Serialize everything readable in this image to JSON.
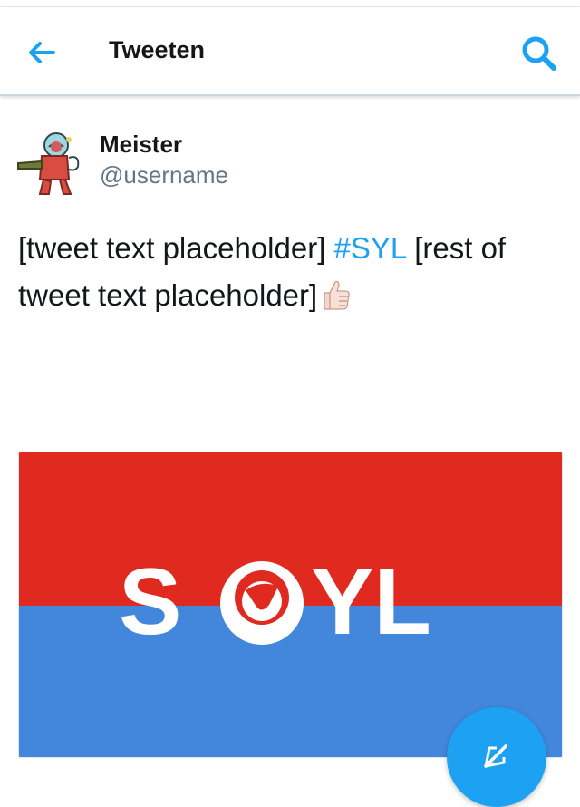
{
  "header": {
    "title": "Tweeten",
    "back_icon": "arrow-left-icon",
    "search_icon": "search-icon"
  },
  "tweet": {
    "display_name": "Meister",
    "handle": "@username",
    "text_before_hashtag": "[tweet text placeholder] ",
    "hashtag": "#SYL",
    "text_after_hashtag": " [rest of tweet text placeholder]",
    "emoji": "thumbs-up-icon",
    "media": {
      "logo_text_left": "S",
      "logo_text_right": "YL",
      "top_color": "#e0291f",
      "bottom_color": "#4287dc"
    }
  },
  "compose": {
    "icon": "compose-icon"
  },
  "colors": {
    "accent": "#1da1f2",
    "handle": "#657786",
    "text": "#14171a"
  }
}
